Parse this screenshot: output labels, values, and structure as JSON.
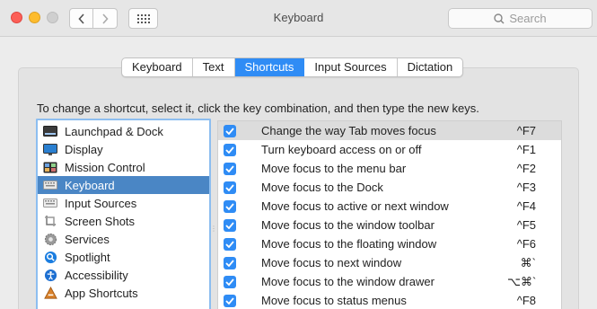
{
  "window": {
    "title": "Keyboard",
    "search_placeholder": "Search"
  },
  "tabs": [
    {
      "label": "Keyboard",
      "active": false
    },
    {
      "label": "Text",
      "active": false
    },
    {
      "label": "Shortcuts",
      "active": true
    },
    {
      "label": "Input Sources",
      "active": false
    },
    {
      "label": "Dictation",
      "active": false
    }
  ],
  "instructions": "To change a shortcut, select it, click the key combination, and then type the new keys.",
  "categories": [
    {
      "label": "Launchpad & Dock",
      "icon": "launchpad-icon",
      "selected": false
    },
    {
      "label": "Display",
      "icon": "display-icon",
      "selected": false
    },
    {
      "label": "Mission Control",
      "icon": "mission-control-icon",
      "selected": false
    },
    {
      "label": "Keyboard",
      "icon": "keyboard-icon",
      "selected": true
    },
    {
      "label": "Input Sources",
      "icon": "input-sources-icon",
      "selected": false
    },
    {
      "label": "Screen Shots",
      "icon": "screenshot-icon",
      "selected": false
    },
    {
      "label": "Services",
      "icon": "gear-icon",
      "selected": false
    },
    {
      "label": "Spotlight",
      "icon": "spotlight-icon",
      "selected": false
    },
    {
      "label": "Accessibility",
      "icon": "accessibility-icon",
      "selected": false
    },
    {
      "label": "App Shortcuts",
      "icon": "app-shortcuts-icon",
      "selected": false
    }
  ],
  "shortcuts": [
    {
      "label": "Change the way Tab moves focus",
      "key": "^F7",
      "checked": true
    },
    {
      "label": "Turn keyboard access on or off",
      "key": "^F1",
      "checked": true
    },
    {
      "label": "Move focus to the menu bar",
      "key": "^F2",
      "checked": true
    },
    {
      "label": "Move focus to the Dock",
      "key": "^F3",
      "checked": true
    },
    {
      "label": "Move focus to active or next window",
      "key": "^F4",
      "checked": true
    },
    {
      "label": "Move focus to the window toolbar",
      "key": "^F5",
      "checked": true
    },
    {
      "label": "Move focus to the floating window",
      "key": "^F6",
      "checked": true
    },
    {
      "label": "Move focus to next window",
      "key": "⌘`",
      "checked": true
    },
    {
      "label": "Move focus to the window drawer",
      "key": "⌥⌘`",
      "checked": true
    },
    {
      "label": "Move focus to status menus",
      "key": "^F8",
      "checked": true
    }
  ],
  "colors": {
    "accent": "#2f8cf5",
    "selected_row": "#4a86c5"
  }
}
